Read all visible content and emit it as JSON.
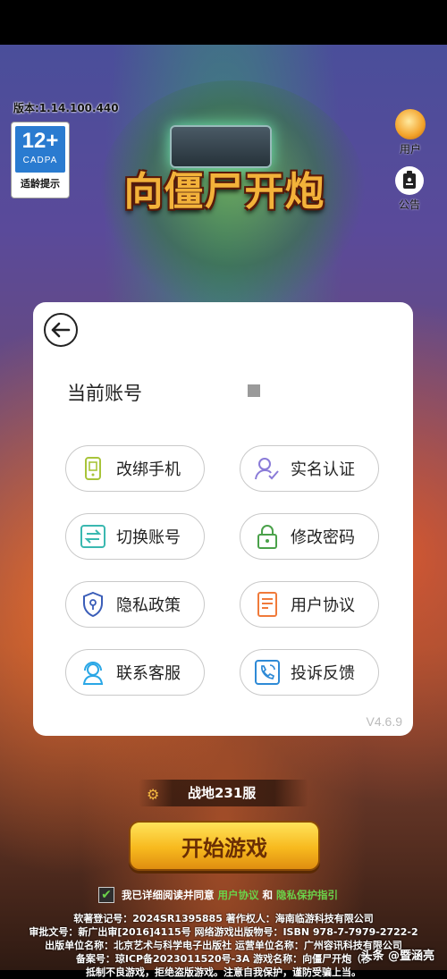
{
  "version_text": "版本:1.14.100.440",
  "age_rating": {
    "number": "12+",
    "org": "CADPA",
    "tip": "适龄提示"
  },
  "logo_title": "向僵尸开炮",
  "side_buttons": {
    "user": "用户",
    "notice": "公告"
  },
  "panel": {
    "current_account_label": "当前账号",
    "options": [
      {
        "label": "改绑手机",
        "icon": "phone-icon",
        "color": "#a8c43a"
      },
      {
        "label": "实名认证",
        "icon": "user-check-icon",
        "color": "#8a7bd8"
      },
      {
        "label": "切换账号",
        "icon": "switch-icon",
        "color": "#3ab8b0"
      },
      {
        "label": "修改密码",
        "icon": "lock-icon",
        "color": "#4aa14a"
      },
      {
        "label": "隐私政策",
        "icon": "shield-icon",
        "color": "#3a5db8"
      },
      {
        "label": "用户协议",
        "icon": "document-icon",
        "color": "#f07a3a"
      },
      {
        "label": "联系客服",
        "icon": "headset-icon",
        "color": "#2aa7e6"
      },
      {
        "label": "投诉反馈",
        "icon": "complaint-phone-icon",
        "color": "#2e8ad6"
      }
    ],
    "version": "V4.6.9"
  },
  "server": {
    "name": "战地231服"
  },
  "start_button": "开始游戏",
  "agreement": {
    "prefix": "我已详细阅读并同意",
    "user_agreement": "用户协议",
    "and": "和",
    "privacy": "隐私保护指引"
  },
  "footer_lines": [
    "软著登记号：2024SR1395885  著作权人：海南临游科技有限公司",
    "审批文号：新广出审[2016]4115号  网络游戏出版物号：ISBN 978-7-7979-2722-2",
    "出版单位名称：北京艺术与科学电子出版社  运营单位名称：广州容讯科技有限公司",
    "备案号：琼ICP备2023011520号-3A  游戏名称：向僵尸开炮（移",
    "抵制不良游戏，拒绝盗版游戏。注意自我保护，谨防受骗上当。"
  ],
  "watermark": "头条 @暨涵亮"
}
